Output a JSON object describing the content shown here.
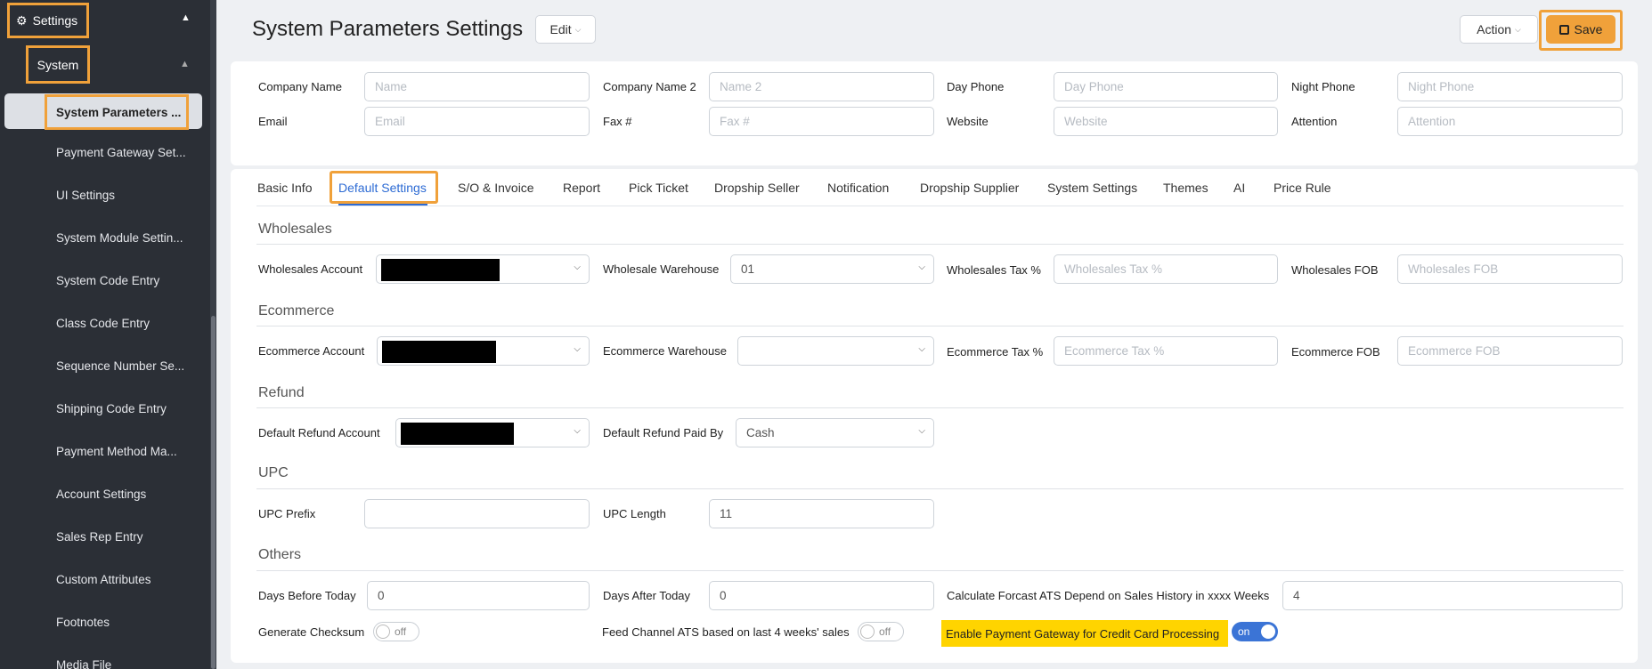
{
  "sidebar": {
    "settings_label": "Settings",
    "system_label": "System",
    "active_item": "System Parameters ...",
    "items": [
      "Payment Gateway Set...",
      "UI Settings",
      "System Module Settin...",
      "System Code Entry",
      "Class Code Entry",
      "Sequence Number Se...",
      "Shipping Code Entry",
      "Payment Method Ma...",
      "Account Settings",
      "Sales Rep Entry",
      "Custom Attributes",
      "Footnotes",
      "Media File"
    ]
  },
  "header": {
    "title": "System Parameters Settings",
    "edit_label": "Edit",
    "action_label": "Action",
    "save_label": "Save"
  },
  "company": {
    "company_name_label": "Company Name",
    "company_name_placeholder": "Name",
    "company_name2_label": "Company Name 2",
    "company_name2_placeholder": "Name 2",
    "day_phone_label": "Day Phone",
    "day_phone_placeholder": "Day Phone",
    "night_phone_label": "Night Phone",
    "night_phone_placeholder": "Night Phone",
    "email_label": "Email",
    "email_placeholder": "Email",
    "fax_label": "Fax #",
    "fax_placeholder": "Fax #",
    "website_label": "Website",
    "website_placeholder": "Website",
    "attention_label": "Attention",
    "attention_placeholder": "Attention"
  },
  "tabs": [
    "Basic Info",
    "Default Settings",
    "S/O & Invoice",
    "Report",
    "Pick Ticket",
    "Dropship Seller",
    "Notification",
    "Dropship Supplier",
    "System Settings",
    "Themes",
    "AI",
    "Price Rule"
  ],
  "wholesales": {
    "title": "Wholesales",
    "account_label": "Wholesales Account",
    "warehouse_label": "Wholesale Warehouse",
    "warehouse_value": "01",
    "tax_label": "Wholesales Tax %",
    "tax_placeholder": "Wholesales Tax %",
    "fob_label": "Wholesales FOB",
    "fob_placeholder": "Wholesales FOB"
  },
  "ecommerce": {
    "title": "Ecommerce",
    "account_label": "Ecommerce Account",
    "warehouse_label": "Ecommerce Warehouse",
    "tax_label": "Ecommerce Tax %",
    "tax_placeholder": "Ecommerce Tax %",
    "fob_label": "Ecommerce FOB",
    "fob_placeholder": "Ecommerce FOB"
  },
  "refund": {
    "title": "Refund",
    "account_label": "Default Refund Account",
    "paid_by_label": "Default Refund Paid By",
    "paid_by_value": "Cash"
  },
  "upc": {
    "title": "UPC",
    "prefix_label": "UPC Prefix",
    "prefix_value": "",
    "length_label": "UPC Length",
    "length_value": "11"
  },
  "others": {
    "title": "Others",
    "days_before_label": "Days Before Today",
    "days_before_value": "0",
    "days_after_label": "Days After Today",
    "days_after_value": "0",
    "forecast_label": "Calculate Forcast ATS Depend on Sales History in xxxx Weeks",
    "forecast_value": "4",
    "checksum_label": "Generate Checksum",
    "checksum_state": "off",
    "feed_label": "Feed Channel ATS based on last 4 weeks' sales",
    "feed_state": "off",
    "gateway_label": "Enable Payment Gateway for Credit Card Processing",
    "gateway_state": "on"
  },
  "colors": {
    "accent": "#f0a13a",
    "tab_active": "#2d6bd4",
    "toggle_on": "#3b74d6",
    "highlight": "#ffd400",
    "sidebar_bg": "#2b2f36"
  }
}
